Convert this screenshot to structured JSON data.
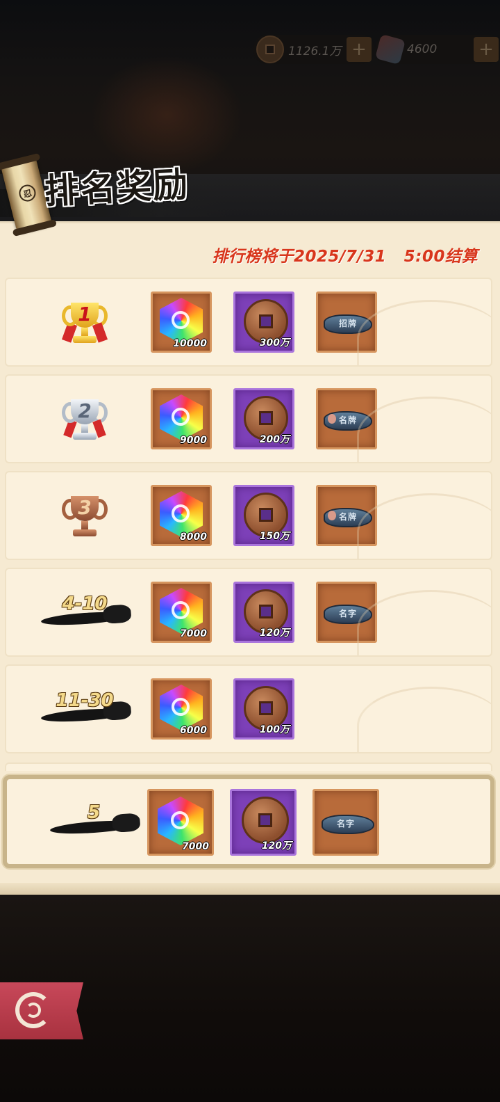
{
  "header": {
    "coins": {
      "icon": "coin-icon",
      "value": "1126.1万"
    },
    "gems": {
      "icon": "gem-icon",
      "value": "4600"
    },
    "plus_label": "+"
  },
  "title": {
    "scroll_glyph": "忍",
    "text": "排名奖励"
  },
  "deadline": "排行榜将于2025/7/31   5:00结算",
  "ranks": [
    {
      "rank": "1",
      "badge": "gold-trophy",
      "gem": "10000",
      "coin": "300万",
      "fragment": "招牌"
    },
    {
      "rank": "2",
      "badge": "silver-trophy",
      "gem": "9000",
      "coin": "200万",
      "fragment": "名牌"
    },
    {
      "rank": "3",
      "badge": "bronze-trophy",
      "gem": "8000",
      "coin": "150万",
      "fragment": "名牌"
    },
    {
      "rank": "4-10",
      "badge": "ink",
      "gem": "7000",
      "coin": "120万",
      "fragment": "名字"
    },
    {
      "rank": "11-30",
      "badge": "ink",
      "gem": "6000",
      "coin": "100万"
    }
  ],
  "my_rank": {
    "rank": "5",
    "gem": "7000",
    "coin": "120万",
    "fragment": "名字"
  },
  "colors": {
    "deadline": "#d8361c",
    "panel": "#f6ead2",
    "orange_frame": "#b86b3a",
    "purple_frame": "#7d40b8",
    "back_button": "#c8485a"
  },
  "icons": {
    "back": "back-spiral-icon"
  }
}
